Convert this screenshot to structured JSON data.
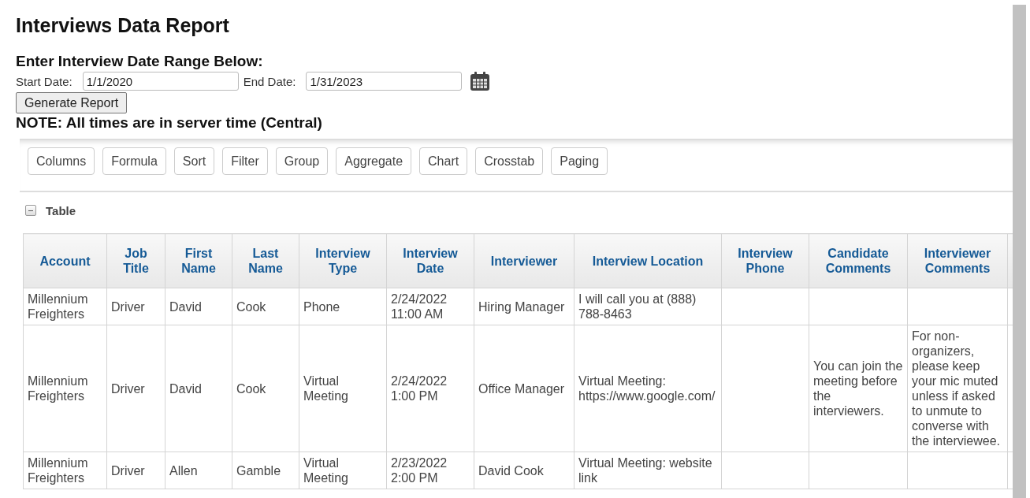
{
  "title": "Interviews Data Report",
  "date_range": {
    "heading": "Enter Interview Date Range Below:",
    "start_label": "Start Date:",
    "start_value": "1/1/2020",
    "end_label": "End Date:",
    "end_value": "1/31/2023"
  },
  "generate_button": "Generate Report",
  "note": "NOTE: All times are in server time (Central)",
  "toolbar": [
    "Columns",
    "Formula",
    "Sort",
    "Filter",
    "Group",
    "Aggregate",
    "Chart",
    "Crosstab",
    "Paging"
  ],
  "section": {
    "label": "Table",
    "expanded": true
  },
  "table": {
    "columns": [
      "Account",
      "Job Title",
      "First Name",
      "Last Name",
      "Interview Type",
      "Interview Date",
      "Interviewer",
      "Interview Location",
      "Interview Phone",
      "Candidate Comments",
      "Interviewer Comments"
    ],
    "rows": [
      [
        "Millennium Freighters",
        "Driver",
        "David",
        "Cook",
        "Phone",
        "2/24/2022 11:00 AM",
        "Hiring Manager",
        "I will call you at (888) 788-8463",
        "",
        "",
        ""
      ],
      [
        "Millennium Freighters",
        "Driver",
        "David",
        "Cook",
        "Virtual Meeting",
        "2/24/2022 1:00 PM",
        "Office Manager",
        "Virtual Meeting: https://www.google.com/",
        "",
        "You can join the meeting before the interviewers.",
        "For non-organizers, please keep your mic muted unless if asked to unmute to converse with the interviewee."
      ],
      [
        "Millennium Freighters",
        "Driver",
        "Allen",
        "Gamble",
        "Virtual Meeting",
        "2/23/2022 2:00 PM",
        "David Cook",
        "Virtual Meeting: website link",
        "",
        "",
        ""
      ]
    ]
  }
}
